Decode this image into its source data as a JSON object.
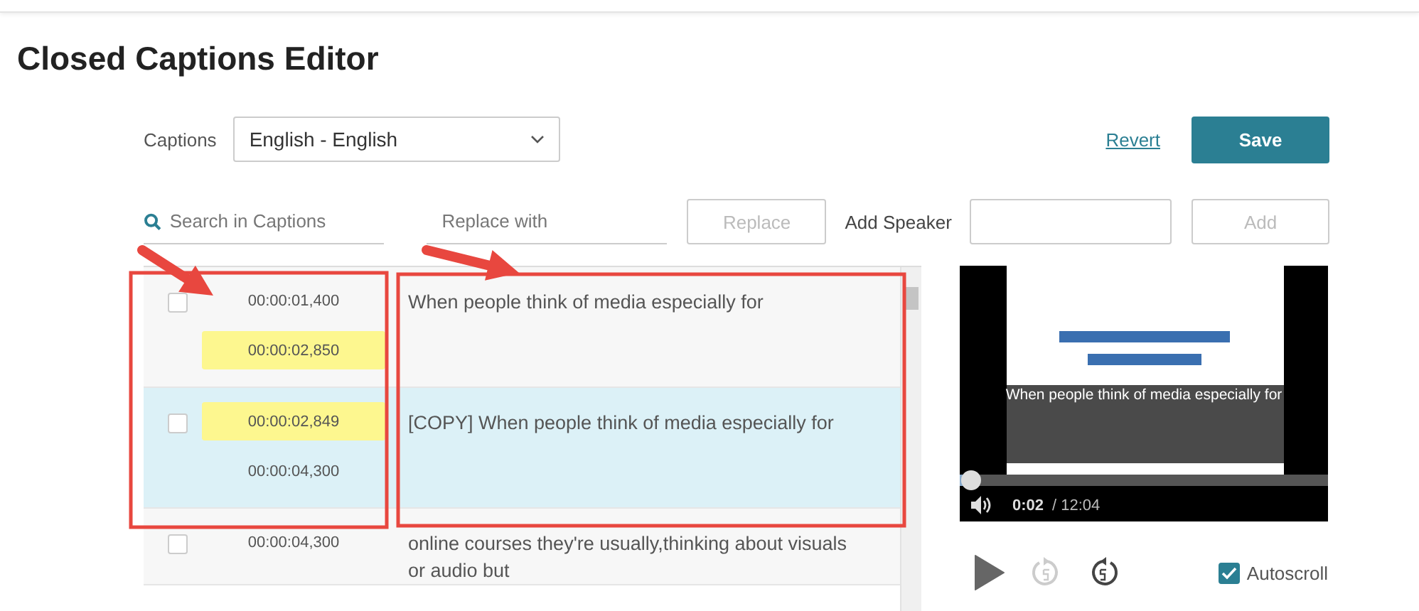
{
  "page_title": "Closed Captions Editor",
  "captions": {
    "label": "Captions",
    "language": "English - English"
  },
  "revert": "Revert",
  "save": "Save",
  "search": {
    "placeholder": "Search in Captions"
  },
  "replace": {
    "placeholder": "Replace with",
    "button": "Replace",
    "disabled": true
  },
  "speaker": {
    "label": "Add Speaker",
    "button": "Add",
    "disabled": true
  },
  "rows": [
    {
      "checked": false,
      "selected": false,
      "start": {
        "time": "00:00:01,400",
        "highlighted": false
      },
      "end": {
        "time": "00:00:02,850",
        "highlighted": true
      },
      "text": "When people think of media especially for"
    },
    {
      "checked": false,
      "selected": true,
      "start": {
        "time": "00:00:02,849",
        "highlighted": true
      },
      "end": {
        "time": "00:00:04,300",
        "highlighted": false
      },
      "text": "[COPY] When people think of media especially for"
    },
    {
      "checked": false,
      "selected": false,
      "start": {
        "time": "00:00:04,300",
        "highlighted": false
      },
      "text": "online courses they're usually,thinking about visuals or audio but"
    }
  ],
  "player": {
    "caption": "When people think of media especially for",
    "level": 0.03,
    "current": "0:02",
    "duration": "/ 12:04",
    "rewind_disabled": true,
    "forward_disabled": false
  },
  "autoscroll": {
    "label": "Autoscroll",
    "checked": true
  }
}
